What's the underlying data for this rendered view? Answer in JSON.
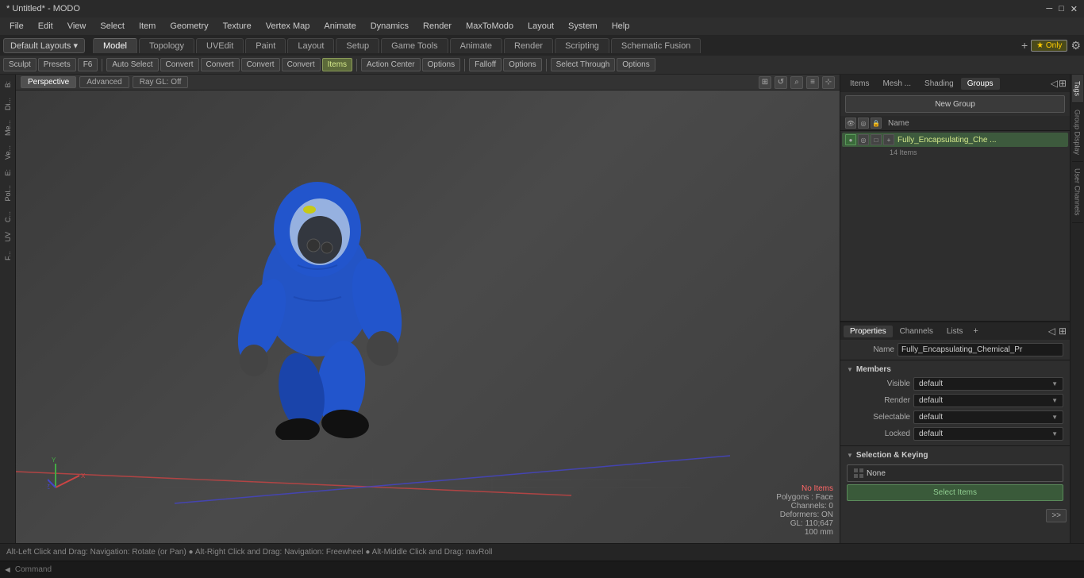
{
  "titlebar": {
    "title": "* Untitled* - MODO",
    "minimize": "─",
    "maximize": "□",
    "close": "✕"
  },
  "menubar": {
    "items": [
      "File",
      "Edit",
      "View",
      "Select",
      "Item",
      "Geometry",
      "Texture",
      "Vertex Map",
      "Animate",
      "Dynamics",
      "Render",
      "MaxToModo",
      "Layout",
      "System",
      "Help"
    ]
  },
  "tabsbar": {
    "layout_label": "Default Layouts ▾",
    "tabs": [
      "Model",
      "Topology",
      "UVEdit",
      "Paint",
      "Layout",
      "Setup",
      "Game Tools",
      "Animate",
      "Render",
      "Scripting",
      "Schematic Fusion"
    ],
    "active_tab": "Model",
    "only_label": "★ Only",
    "plus_icon": "+"
  },
  "toolbar": {
    "sculpt_label": "Sculpt",
    "presets_label": "Presets",
    "f6_label": "F6",
    "autoselect_label": "Auto Select",
    "convert1_label": "Convert",
    "convert2_label": "Convert",
    "convert3_label": "Convert",
    "convert4_label": "Convert",
    "items_label": "Items",
    "action_center_label": "Action Center",
    "options_label": "Options",
    "falloff_label": "Falloff",
    "options2_label": "Options",
    "select_through_label": "Select Through",
    "options3_label": "Options"
  },
  "viewport": {
    "tabs": [
      "Perspective",
      "Advanced",
      "Ray GL: Off"
    ],
    "active_tab": "Perspective"
  },
  "left_sidebar": {
    "items": [
      "B:",
      "Di...",
      "Me...",
      "Ve...",
      "E:",
      "Pol...",
      "C...",
      "UV",
      "F..."
    ]
  },
  "right_panel": {
    "tabs": [
      "Items",
      "Mesh ...",
      "Shading",
      "Groups"
    ],
    "active_tab": "Groups",
    "new_group_label": "New Group",
    "name_column": "Name",
    "group_name": "Fully_Encapsulating_Che ...",
    "group_count": "14 Items"
  },
  "properties": {
    "tabs": [
      "Properties",
      "Channels",
      "Lists"
    ],
    "active_tab": "Properties",
    "plus_label": "+",
    "name_label": "Name",
    "name_value": "Fully_Encapsulating_Chemical_Pr",
    "members_label": "Members",
    "visible_label": "Visible",
    "visible_value": "default",
    "render_label": "Render",
    "render_value": "default",
    "selectable_label": "Selectable",
    "selectable_value": "default",
    "locked_label": "Locked",
    "locked_value": "default",
    "sel_keying_label": "Selection & Keying",
    "none_label": "None",
    "select_items_label": "Select Items"
  },
  "right_side_tabs": {
    "items": [
      "Tags",
      "Group Display",
      "User Channels"
    ]
  },
  "statusbar": {
    "text": "Alt-Left Click and Drag: Navigation: Rotate (or Pan) ● Alt-Right Click and Drag: Navigation: Freewheel ● Alt-Middle Click and Drag: navRoll"
  },
  "commandbar": {
    "arrow_left": "◄",
    "placeholder": "Command"
  },
  "viewport_status": {
    "no_items": "No Items",
    "polygons": "Polygons : Face",
    "channels": "Channels: 0",
    "deformers": "Deformers: ON",
    "gl": "GL: 110;647",
    "zoom": "100 mm"
  }
}
